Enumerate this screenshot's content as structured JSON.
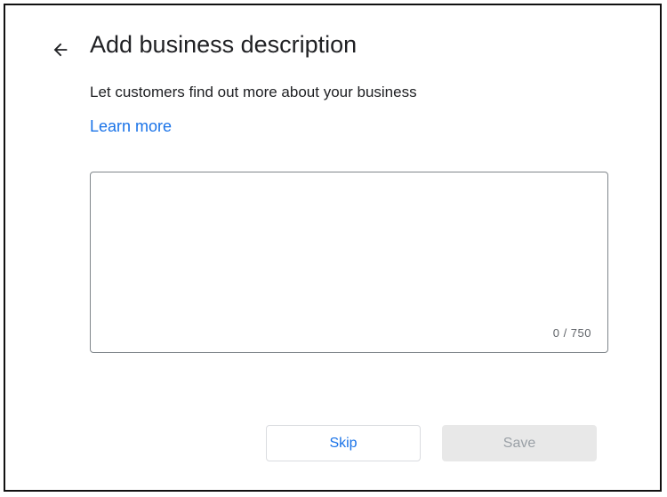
{
  "dialog": {
    "title": "Add business description",
    "subtitle": "Let customers find out more about your business",
    "learn_more_label": "Learn more",
    "back_icon": "arrow-back-icon"
  },
  "description": {
    "value": "",
    "placeholder": "",
    "counter": "0 / 750",
    "max_length": 750
  },
  "actions": {
    "skip_label": "Skip",
    "save_label": "Save",
    "save_enabled": false
  },
  "colors": {
    "accent": "#1a73e8",
    "text_primary": "#202124",
    "text_secondary": "#5f6368",
    "disabled_bg": "#e8e8e8",
    "disabled_text": "#9aa0a6"
  }
}
